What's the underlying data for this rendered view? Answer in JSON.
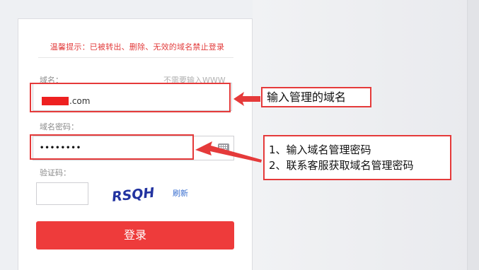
{
  "notice": "温馨提示：已被转出、删除、无效的域名禁止登录",
  "domain_field": {
    "label": "域名：",
    "hint": "不需要输入WWW",
    "value_suffix": ".com"
  },
  "password_field": {
    "label": "域名密码：",
    "value": "••••••••"
  },
  "captcha": {
    "label": "验证码：",
    "image_text": "RSQH",
    "refresh_label": "刷新"
  },
  "login_button": "登录",
  "annotations": {
    "domain_note": "输入管理的域名",
    "password_note_1": "1、输入域名管理密码",
    "password_note_2": "2、联系客服获取域名管理密码",
    "highlight_color": "#e53a3a"
  },
  "colors": {
    "accent": "#ee3b3b",
    "notice_text": "#e23b3b",
    "link": "#3a6fd0"
  }
}
